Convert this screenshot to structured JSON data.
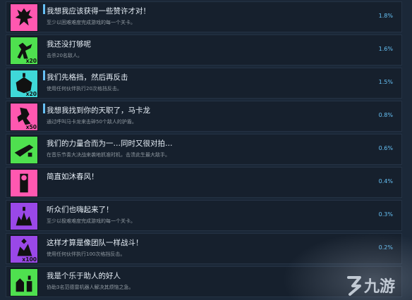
{
  "achievements": [
    {
      "title": "我想我应该获得一些赞许才对！",
      "desc": "至少以困难难度完成游戏的每一个关卡。",
      "percent": "1.8%",
      "icon_name": "demon-figure-icon",
      "icon_color": "#ff58b0",
      "fill_color": "#2a1424",
      "has_bar": true
    },
    {
      "title": "我还没打够呢",
      "desc": "击杀20名敌人。",
      "percent": "1.6%",
      "icon_name": "fighter-kick-icon",
      "icon_color": "#4fe04f",
      "fill_color": "#102a10",
      "badge": "x20",
      "has_bar": false
    },
    {
      "title": "我们先格挡，然后再反击",
      "desc": "使用任何伙伴执行20次格挡反击。",
      "percent": "1.5%",
      "icon_name": "shield-counter-icon",
      "icon_color": "#3fd8d8",
      "fill_color": "#0c2628",
      "badge": "x20",
      "has_bar": true
    },
    {
      "title": "我想我找到你的天职了，马卡龙",
      "desc": "通过呼叫马卡龙来击碎50个敌人的护盾。",
      "percent": "0.8%",
      "icon_name": "smash-figure-icon",
      "icon_color": "#ff58b0",
      "fill_color": "#2a1424",
      "badge": "x50",
      "has_bar": true
    },
    {
      "title": "我们的力量合而为一…同时又很对拍…",
      "desc": "在音乐节奏大决战来袭地抓准时机，击溃此生最大敌手。",
      "percent": "0.6%",
      "icon_name": "beat-cannon-icon",
      "icon_color": "#4fe04f",
      "fill_color": "#102a10",
      "has_bar": false
    },
    {
      "title": "简直如沐春风！",
      "desc": "",
      "percent": "0.4%",
      "icon_name": "speaker-figure-icon",
      "icon_color": "#ff58b0",
      "fill_color": "#2a1424",
      "has_bar": false
    },
    {
      "title": "听众们也嗨起来了！",
      "desc": "至少以极难难度完成游戏的每一个关卡。",
      "percent": "0.3%",
      "icon_name": "crowd-hype-icon",
      "icon_color": "#9a48e8",
      "fill_color": "#1c1230",
      "has_bar": false
    },
    {
      "title": "这样才算是像团队一样战斗！",
      "desc": "使用任何伙伴执行100次格挡反击。",
      "percent": "0.2%",
      "icon_name": "team-counter-icon",
      "icon_color": "#9a48e8",
      "fill_color": "#1c1230",
      "badge": "x100",
      "has_bar": false
    },
    {
      "title": "我是个乐于助人的好人",
      "desc": "协助3名范德雷机器人解决其烦恼之急。",
      "percent": "",
      "icon_name": "helper-robot-icon",
      "icon_color": "#4fe04f",
      "fill_color": "#102a10",
      "has_bar": false
    }
  ],
  "watermark": {
    "text": "九游"
  }
}
